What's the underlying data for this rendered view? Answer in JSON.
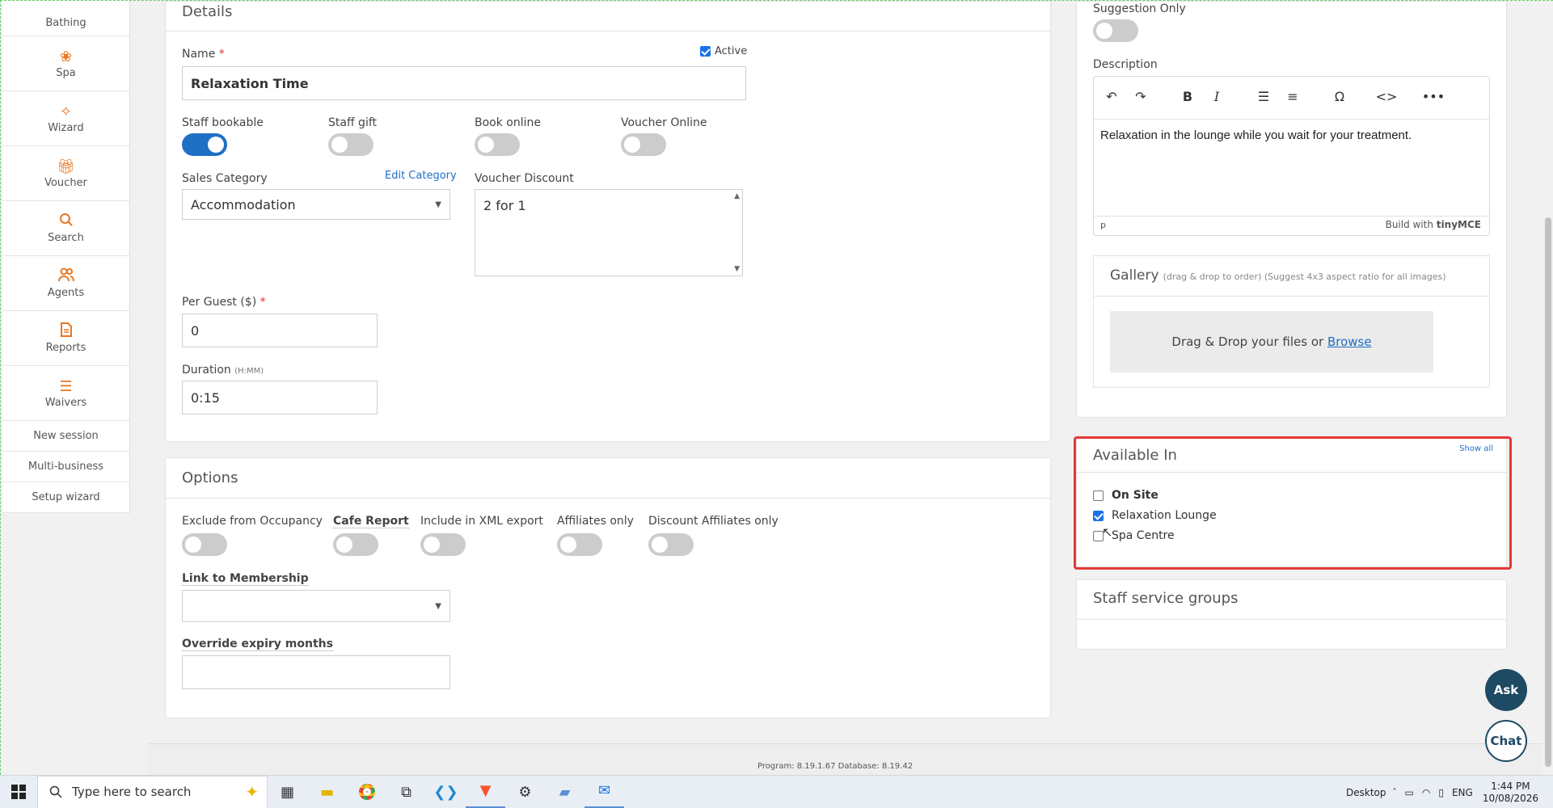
{
  "sidebar": {
    "items": [
      {
        "label": "Bathing",
        "icon": "bathing-icon"
      },
      {
        "label": "Spa",
        "icon": "spa-icon"
      },
      {
        "label": "Wizard",
        "icon": "wand-icon"
      },
      {
        "label": "Voucher",
        "icon": "gift-icon"
      },
      {
        "label": "Search",
        "icon": "search-icon"
      },
      {
        "label": "Agents",
        "icon": "users-icon"
      },
      {
        "label": "Reports",
        "icon": "report-icon"
      },
      {
        "label": "Waivers",
        "icon": "list-icon"
      }
    ],
    "links": [
      "New session",
      "Multi-business",
      "Setup wizard"
    ]
  },
  "details": {
    "title": "Details",
    "name_label": "Name",
    "name_required": "*",
    "active_label": "Active",
    "active_checked": true,
    "name_value": "Relaxation Time",
    "toggles": [
      {
        "label": "Staff bookable",
        "on": true
      },
      {
        "label": "Staff gift",
        "on": false
      },
      {
        "label": "Book online",
        "on": false
      },
      {
        "label": "Voucher Online",
        "on": false
      }
    ],
    "sales_category_label": "Sales Category",
    "edit_category_label": "Edit Category",
    "sales_category_value": "Accommodation",
    "voucher_discount_label": "Voucher Discount",
    "voucher_discount_value": "2 for 1",
    "per_guest_label": "Per Guest ($)",
    "per_guest_required": "*",
    "per_guest_value": "0",
    "duration_label": "Duration",
    "duration_hint": "(H:MM)",
    "duration_value": "0:15"
  },
  "options": {
    "title": "Options",
    "toggles": [
      {
        "label": "Exclude from Occupancy",
        "on": false
      },
      {
        "label": "Cafe Report",
        "on": false
      },
      {
        "label": "Include in XML export",
        "on": false
      },
      {
        "label": "Affiliates only",
        "on": false
      },
      {
        "label": "Discount Affiliates only",
        "on": false
      }
    ],
    "link_membership_label": "Link to Membership",
    "link_membership_value": "",
    "override_expiry_label": "Override expiry months",
    "override_expiry_value": ""
  },
  "right": {
    "suggestion_only_label": "Suggestion Only",
    "suggestion_only_on": false,
    "description_label": "Description",
    "description_text": "Relaxation in the lounge while you wait for your treatment.",
    "editor_path": "p",
    "editor_branding": "Build with",
    "editor_brand_name": "tinyMCE",
    "gallery_title": "Gallery",
    "gallery_hint": "(drag & drop to order) (Suggest 4x3 aspect ratio for all images)",
    "gallery_drop_text": "Drag & Drop your files or",
    "gallery_browse": "Browse",
    "available_title": "Available In",
    "show_all": "Show all",
    "available_items": [
      {
        "label": "On Site",
        "checked": false,
        "bold": true
      },
      {
        "label": "Relaxation Lounge",
        "checked": true,
        "bold": false
      },
      {
        "label": "Spa Centre",
        "checked": false,
        "bold": false
      }
    ],
    "staff_groups_title": "Staff service groups"
  },
  "footer": {
    "version": "Program: 8.19.1.67 Database: 8.19.42"
  },
  "fabs": {
    "ask": "Ask",
    "chat": "Chat"
  },
  "taskbar": {
    "search_placeholder": "Type here to search",
    "desktop_label": "Desktop",
    "lang": "ENG",
    "time": "1:44 PM",
    "date": "10/08/2026"
  },
  "colors": {
    "accent": "#1f6fc5",
    "brand": "#e87722",
    "highlight": "#e53935",
    "fab": "#1e4a63"
  }
}
